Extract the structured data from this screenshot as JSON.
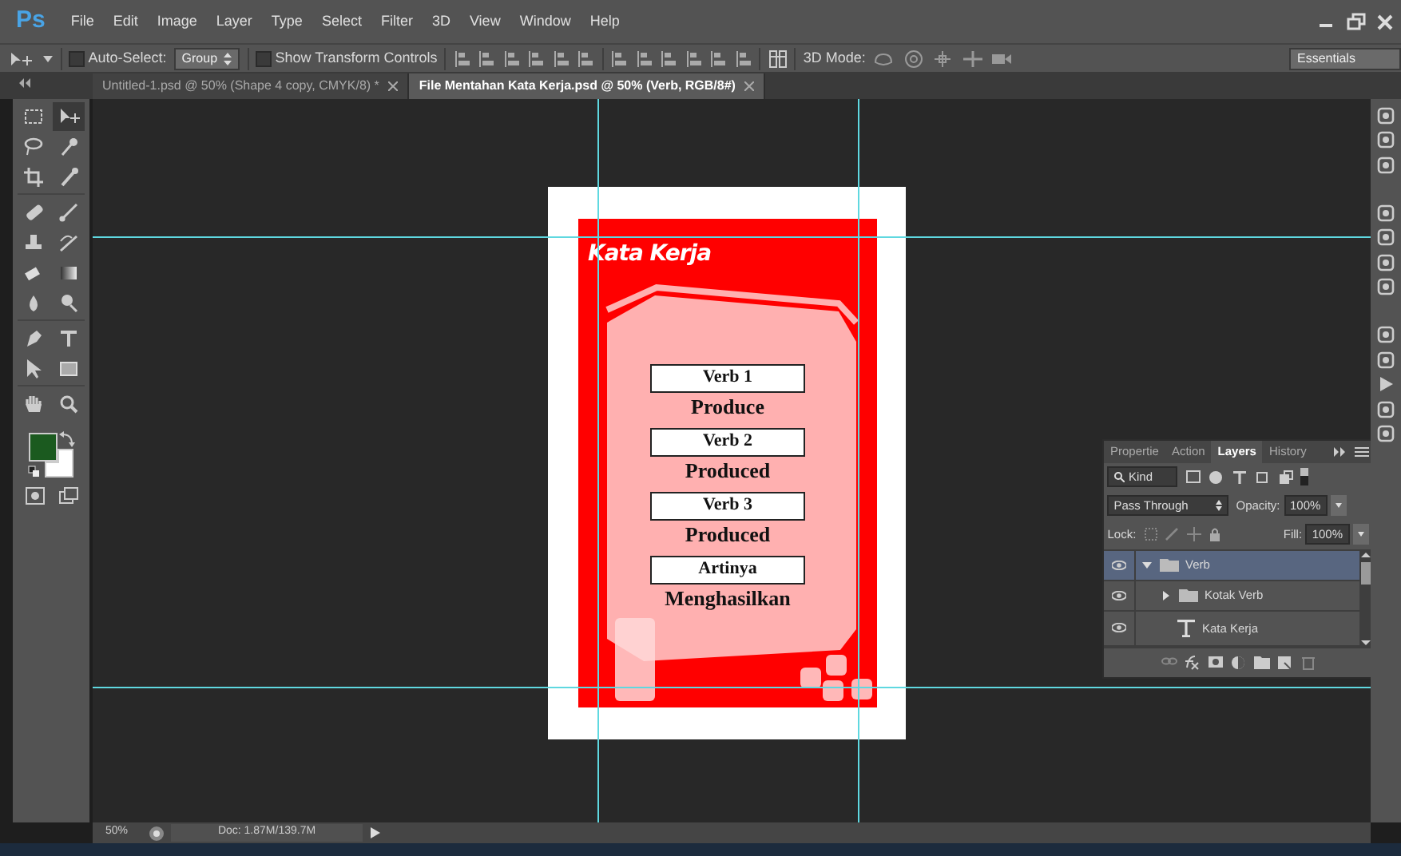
{
  "app": {
    "logo": "Ps"
  },
  "menu": [
    "File",
    "Edit",
    "Image",
    "Layer",
    "Type",
    "Select",
    "Filter",
    "3D",
    "View",
    "Window",
    "Help"
  ],
  "options_bar": {
    "auto_select": {
      "label": "Auto-Select:",
      "checked": false
    },
    "target": "Group",
    "transform": {
      "label": "Show Transform Controls",
      "checked": false
    },
    "mode_label": "3D Mode:",
    "workspace": "Essentials"
  },
  "tabs": [
    {
      "label": "Untitled-1.psd @ 50% (Shape 4 copy, CMYK/8) *",
      "selected": false
    },
    {
      "label": "File Mentahan Kata Kerja.psd @ 50% (Verb, RGB/8#)",
      "selected": true
    }
  ],
  "tools": [
    {
      "kind": "marquee",
      "selected": false
    },
    {
      "kind": "move",
      "selected": true
    },
    {
      "kind": "lasso",
      "selected": false
    },
    {
      "kind": "wand",
      "selected": false
    },
    {
      "kind": "crop",
      "selected": false
    },
    {
      "kind": "dropper",
      "selected": false
    },
    {
      "kind": "healing",
      "selected": false
    },
    {
      "kind": "brush",
      "selected": false
    },
    {
      "kind": "stamp",
      "selected": false
    },
    {
      "kind": "history",
      "selected": false
    },
    {
      "kind": "eraser",
      "selected": false
    },
    {
      "kind": "gradient",
      "selected": false
    },
    {
      "kind": "blur",
      "selected": false
    },
    {
      "kind": "dodge",
      "selected": false
    },
    {
      "kind": "pen",
      "selected": false
    },
    {
      "kind": "type",
      "selected": false
    },
    {
      "kind": "pointer",
      "selected": false
    },
    {
      "kind": "shape",
      "selected": false
    },
    {
      "kind": "hand",
      "selected": false
    },
    {
      "kind": "zoom",
      "selected": false
    }
  ],
  "swatches": [
    {
      "kind": "foreground",
      "color": "#1b5a1f"
    },
    {
      "kind": "background",
      "color": "#ffffff"
    }
  ],
  "document": {
    "title": "Kata Kerja",
    "entries": [
      {
        "label": "Verb 1",
        "value": "Produce"
      },
      {
        "label": "Verb 2",
        "value": "Produced"
      },
      {
        "label": "Verb 3",
        "value": "Produced"
      },
      {
        "label": "Artinya",
        "value": "Menghasilkan"
      }
    ]
  },
  "layers_panel": {
    "tabs": [
      {
        "label": "Propertie",
        "selected": false
      },
      {
        "label": "Action",
        "selected": false
      },
      {
        "label": "Layers",
        "selected": true
      },
      {
        "label": "History",
        "selected": false
      }
    ],
    "filter": "Kind",
    "blend_mode": "Pass Through",
    "opacity_label": "Opacity:",
    "opacity": "100%",
    "lock_label": "Lock:",
    "fill_label": "Fill:",
    "fill": "100%",
    "layers": [
      {
        "kind": "group",
        "name": "Verb",
        "expanded": true,
        "selected": true,
        "visible": true,
        "children": [
          {
            "kind": "group",
            "name": "Kotak Verb",
            "expanded": false,
            "selected": false,
            "visible": true
          },
          {
            "kind": "text",
            "name": "Kata Kerja",
            "selected": false,
            "visible": true
          }
        ]
      }
    ]
  },
  "status_bar": {
    "zoom": "50%",
    "doc": "Doc: 1.87M/139.7M"
  }
}
